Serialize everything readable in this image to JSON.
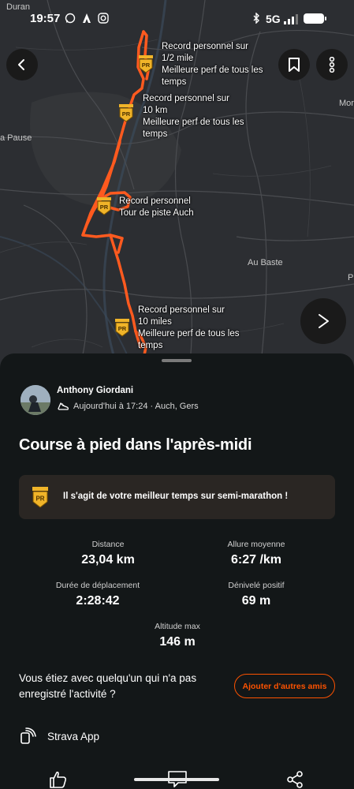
{
  "status_bar": {
    "time": "19:57",
    "network": "5G",
    "left_icons": [
      "whatsapp-icon",
      "strava-icon",
      "instagram-icon"
    ],
    "right_icons": [
      "bluetooth-icon",
      "signal-icon",
      "battery-icon"
    ]
  },
  "map": {
    "places": [
      "Duran",
      "Mor",
      "a Pause",
      "Au Baste",
      "P"
    ],
    "personal_records": [
      {
        "lines": [
          "Record personnel sur",
          "1/2 mile",
          "Meilleure perf de tous les",
          "temps"
        ]
      },
      {
        "lines": [
          "Record personnel sur",
          "10 km",
          "Meilleure perf de tous les",
          "temps"
        ]
      },
      {
        "lines": [
          "Record personnel",
          "Tour de piste Auch"
        ]
      },
      {
        "lines": [
          "Record personnel sur",
          "10 miles",
          "Meilleure perf de tous les",
          "temps"
        ]
      }
    ],
    "badge_text": "PR",
    "route_color": "#ff5a1f"
  },
  "activity": {
    "athlete_name": "Anthony Giordani",
    "meta": "Aujourd'hui à 17:24 · Auch, Gers",
    "title": "Course à pied dans l'après-midi",
    "pr_banner": "Il s'agit de votre meilleur temps sur semi-marathon !",
    "stats": {
      "distance": {
        "label": "Distance",
        "value": "23,04 km"
      },
      "pace": {
        "label": "Allure moyenne",
        "value": "6:27 /km"
      },
      "moving_time": {
        "label": "Durée de déplacement",
        "value": "2:28:42"
      },
      "elevation": {
        "label": "Dénivelé positif",
        "value": "69 m"
      },
      "max_altitude": {
        "label": "Altitude max",
        "value": "146 m"
      }
    },
    "friends_question": "Vous étiez avec quelqu'un qui n'a pas enregistré l'activité ?",
    "add_friends_button": "Ajouter d'autres amis",
    "device": "Strava App"
  },
  "colors": {
    "accent": "#fc5200",
    "sheet_bg": "#131718",
    "badge_gold": "#f0b429"
  }
}
